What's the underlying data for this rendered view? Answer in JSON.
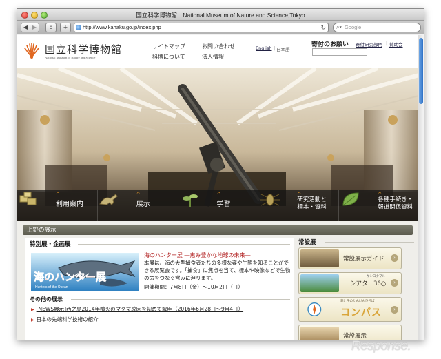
{
  "browser": {
    "window_title": "国立科学博物館　National Museum of Nature and Science,Tokyo",
    "url": "http://www.kahaku.go.jp/index.php",
    "search_placeholder": "Google",
    "back_icon": "back-arrow-icon",
    "forward_icon": "forward-arrow-icon",
    "home_icon": "home-icon",
    "add_icon": "plus-icon",
    "reload_icon": "reload-icon"
  },
  "header": {
    "logo_jp": "国立科学博物館",
    "logo_en": "National Museum of Nature and Science",
    "links": [
      "サイトマップ",
      "お問い合わせ",
      "科博について",
      "法人情報"
    ],
    "lang_english": "English",
    "lang_separator": "|",
    "lang_japanese": "日本語",
    "donate_title": "寄付のお願い",
    "donate_links": [
      "寄付研究部門",
      "賛助会"
    ],
    "donate_separator": "|"
  },
  "hero": {
    "menu": [
      {
        "label": "利用案内",
        "icon": "boxes-icon"
      },
      {
        "label": "展示",
        "icon": "dinosaur-icon"
      },
      {
        "label": "学習",
        "icon": "plant-icon"
      },
      {
        "label": "研究活動と\n標本・資料",
        "icon": "insect-icon"
      },
      {
        "label": "各種手続き・\n報道関係資料",
        "icon": "leaf-icon"
      }
    ],
    "colors": {
      "menu_caret": "#e59a2a"
    }
  },
  "ueno": {
    "section_title": "上野の展示",
    "special_heading": "特別展・企画展",
    "exhibition": {
      "image_title": "海のハンター展",
      "image_subtitle": "Hunters of the Ocean",
      "title": "海のハンター展 ―恵み豊かな地球の未来―",
      "description": "本展は、海の大型捕食者たちの多様な姿や生態を知ることができる展覧会です。「捕食」に焦点を当て、標本や映像などで生物の命をつなぐ営みに迫ります。",
      "period": "開催期間：7月8日（金）〜10月2日（日）"
    },
    "other_heading": "その他の展示",
    "news": [
      "[NEWS展示]西之島2014年噴火のマグマ成因を初めて解明（2016年6月28日〜9月4日）",
      "日本の先端科学技術の紹介"
    ],
    "permanent_heading": "常設展",
    "banners": [
      {
        "label": "常設展示ガイド",
        "ruby": "",
        "thumb": "gallery-thumb"
      },
      {
        "label": "シアター36○",
        "ruby": "サンロクマル",
        "thumb": "theater-thumb"
      },
      {
        "label": "コンパス",
        "ruby": "親と子のたんけんひろば",
        "thumb": "compass-thumb"
      },
      {
        "label": "常設展示",
        "ruby": "",
        "thumb": "exhibit-thumb"
      }
    ],
    "arrow_glyph": "›"
  },
  "watermark": "Response."
}
